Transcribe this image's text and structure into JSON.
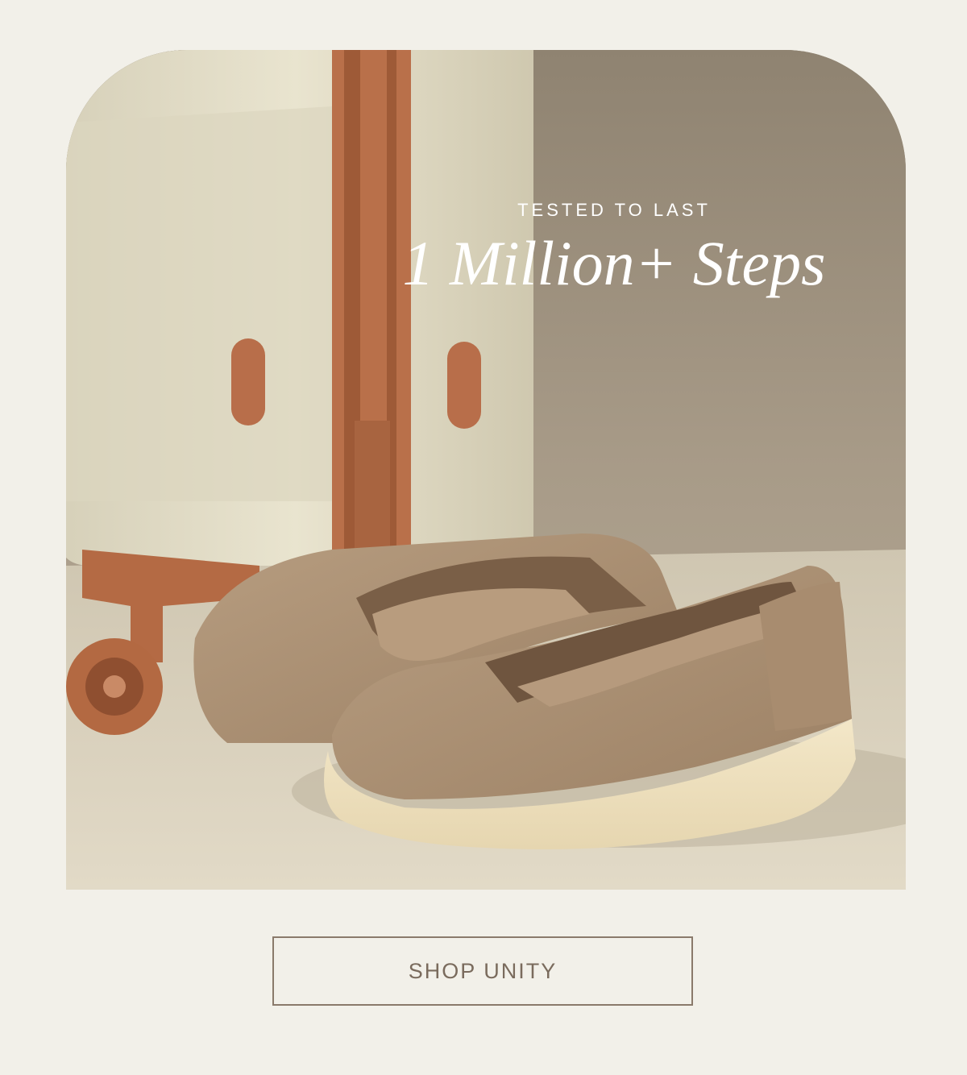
{
  "hero": {
    "eyebrow": "TESTED TO LAST",
    "headline": "1 Million+ Steps",
    "image_subject": "beige-knit-slip-on-shoes-beside-cream-suitcase"
  },
  "cta": {
    "label": "SHOP UNITY"
  },
  "colors": {
    "page_background": "#f2f0e9",
    "cta_border": "#8a7a6b",
    "cta_text": "#7a6b5d",
    "headline_text": "#ffffff"
  }
}
